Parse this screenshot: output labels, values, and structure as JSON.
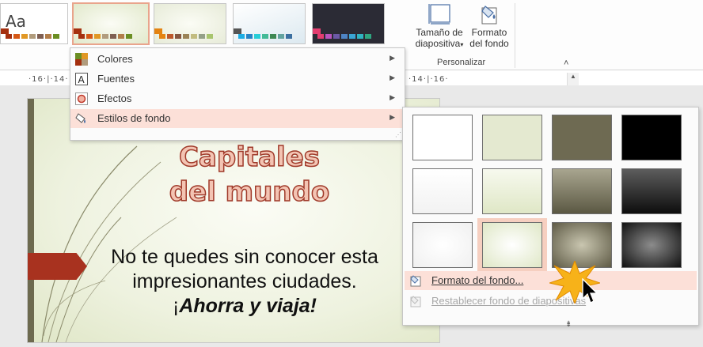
{
  "ribbon": {
    "themes": [
      {
        "name": "theme-office",
        "preview_text": "Aa",
        "colors": [
          "#a5300f",
          "#d55816",
          "#e19825",
          "#b19c7d",
          "#7f5f52",
          "#b27d49",
          "#6b8e23"
        ]
      },
      {
        "name": "theme-facet",
        "colors": [
          "#a5300f",
          "#d55816",
          "#e19825",
          "#b19c7d",
          "#7f5f52",
          "#b27d49",
          "#6b8e23"
        ]
      },
      {
        "name": "theme-ion",
        "colors": [
          "#e48312",
          "#bd582c",
          "#865640",
          "#9b8357",
          "#c2bc80",
          "#94a088",
          "#a8c56e"
        ]
      },
      {
        "name": "theme-retrospect",
        "colors": [
          "#1cade4",
          "#2683c6",
          "#27ced7",
          "#42ba97",
          "#3e8853",
          "#62a39f",
          "#3b6fa0"
        ]
      },
      {
        "name": "theme-dark",
        "colors": [
          "#e33d6f",
          "#b955bd",
          "#6b59a6",
          "#4e84c4",
          "#3aa5d5",
          "#30b4c1",
          "#2fa680"
        ]
      }
    ],
    "slide_size_label_1": "Tamaño de",
    "slide_size_label_2": "diapositiva",
    "slide_size_caret": "▾",
    "format_bg_label_1": "Formato",
    "format_bg_label_2": "del fondo",
    "group_label": "Personalizar",
    "collapse": "˄",
    "ruler_left": "·16·|·14·",
    "ruler_right": "·14·|·16·"
  },
  "design_menu": {
    "items": [
      {
        "label": "Colores",
        "icon": "color-palette-icon",
        "arrow": "▶"
      },
      {
        "label": "Fuentes",
        "icon": "font-a-icon",
        "arrow": "▶"
      },
      {
        "label": "Efectos",
        "icon": "effects-circle-icon",
        "arrow": "▶"
      },
      {
        "label": "Estilos de fondo",
        "icon": "paint-bucket-icon",
        "arrow": "▶"
      }
    ]
  },
  "bg_panel": {
    "swatches": [
      {
        "name": "bg-style-1",
        "fill": "#ffffff"
      },
      {
        "name": "bg-style-2",
        "fill": "#e4e9d0"
      },
      {
        "name": "bg-style-3",
        "fill": "#6e6a52"
      },
      {
        "name": "bg-style-4",
        "fill": "#000000"
      },
      {
        "name": "bg-style-5",
        "fill": "linear-gradient(#ffffff,#f2f2f2)"
      },
      {
        "name": "bg-style-6",
        "fill": "linear-gradient(#f7f9ee,#dfe7c6)"
      },
      {
        "name": "bg-style-7",
        "fill": "linear-gradient(#a8a58f,#5b5843)"
      },
      {
        "name": "bg-style-8",
        "fill": "linear-gradient(#5d5d5d,#0d0d0d)"
      },
      {
        "name": "bg-style-9",
        "fill": "radial-gradient(ellipse at center,#ffffff 0%,#f0f0f0 100%)"
      },
      {
        "name": "bg-style-10",
        "fill": "radial-gradient(ellipse at center,#ffffff 0%,#dfe7c6 100%)"
      },
      {
        "name": "bg-style-11",
        "fill": "radial-gradient(ellipse at center,#c9c6b0 0%,#5e5a45 100%)"
      },
      {
        "name": "bg-style-12",
        "fill": "radial-gradient(ellipse at center,#8c8c8c 0%,#111111 100%)"
      }
    ],
    "selected_index": 9,
    "format_background": "Formato del fondo...",
    "reset_background": "Restablecer fondo de diapositivas",
    "more": "⇟"
  },
  "slide": {
    "title_line_1": "Capitales",
    "title_line_2": "del mundo",
    "subtitle_line_1": "No te quedes sin conocer esta",
    "subtitle_line_2": "impresionantes ciudades.",
    "cta_open": "¡",
    "cta": "Ahorra y viaja!"
  }
}
